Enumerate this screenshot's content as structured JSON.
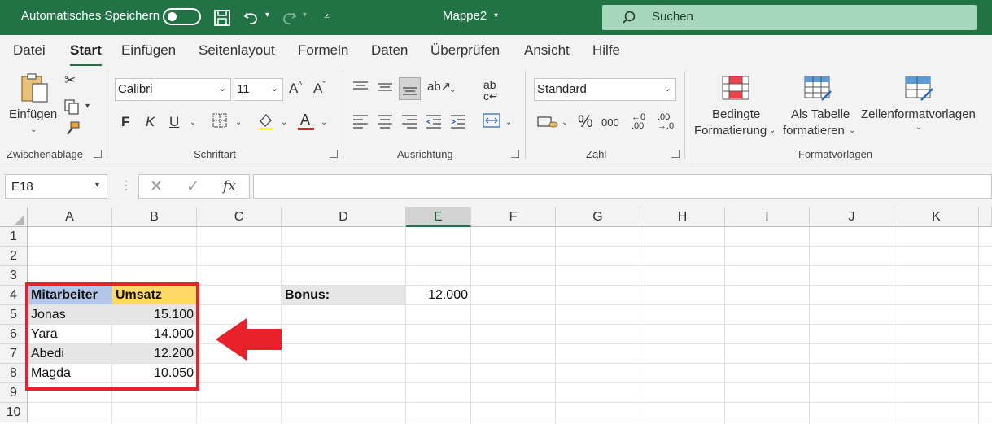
{
  "titlebar": {
    "autosave_label": "Automatisches Speichern",
    "doc_title": "Mappe2",
    "search_placeholder": "Suchen"
  },
  "tabs": [
    "Datei",
    "Start",
    "Einfügen",
    "Seitenlayout",
    "Formeln",
    "Daten",
    "Überprüfen",
    "Ansicht",
    "Hilfe"
  ],
  "ribbon": {
    "clipboard": {
      "paste_label": "Einfügen",
      "group": "Zwischenablage"
    },
    "font": {
      "name": "Calibri",
      "size": "11",
      "group": "Schriftart",
      "bold": "F",
      "italic": "K",
      "underline": "U"
    },
    "alignment": {
      "group": "Ausrichtung"
    },
    "number": {
      "format": "Standard",
      "group": "Zahl",
      "thousands": "000"
    },
    "styles": {
      "conditional_line1": "Bedingte",
      "conditional_line2": "Formatierung",
      "table_line1": "Als Tabelle",
      "table_line2": "formatieren",
      "cellstyles": "Zellenformatvorlagen",
      "group": "Formatvorlagen"
    }
  },
  "formula_bar": {
    "name_box": "E18",
    "fx": "fx",
    "formula": ""
  },
  "grid": {
    "columns": [
      "A",
      "B",
      "C",
      "D",
      "E",
      "F",
      "G",
      "H",
      "I",
      "J",
      "K"
    ],
    "selected_column": "E",
    "rows": [
      "1",
      "2",
      "3",
      "4",
      "5",
      "6",
      "7",
      "8",
      "9",
      "10"
    ],
    "table": {
      "header_a": "Mitarbeiter",
      "header_b": "Umsatz",
      "rows": [
        {
          "name": "Jonas",
          "value": "15.100"
        },
        {
          "name": "Yara",
          "value": "14.000"
        },
        {
          "name": "Abedi",
          "value": "12.200"
        },
        {
          "name": "Magda",
          "value": "10.050"
        }
      ]
    },
    "bonus_label": "Bonus:",
    "bonus_value": "12.000"
  },
  "colors": {
    "excel_green": "#217346",
    "header_blue": "#b4c6e7",
    "header_yellow": "#ffd966",
    "band_gray": "#e7e6e6",
    "highlight_red": "#e8212b"
  }
}
